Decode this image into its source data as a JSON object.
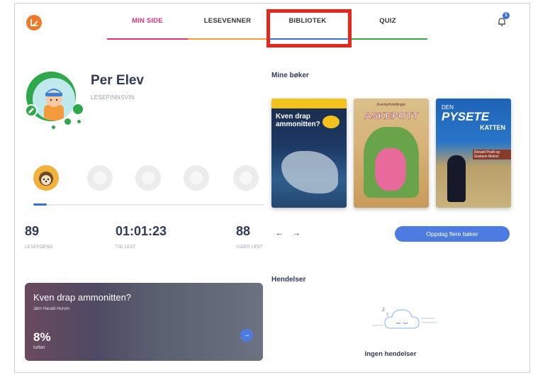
{
  "header": {
    "tabs": [
      {
        "label": "MIN SIDE"
      },
      {
        "label": "LESEVENNER"
      },
      {
        "label": "BIBLIOTEK"
      },
      {
        "label": "QUIZ"
      }
    ],
    "notification_count": "1",
    "colors": {
      "active_tab": "#e0317e",
      "highlight": "#e8271c"
    }
  },
  "profile": {
    "name": "Per Elev",
    "level": "LESEPINNSVIN"
  },
  "badges": {
    "active_index": 0,
    "count": 5,
    "progress_fraction": 0.06
  },
  "stats": [
    {
      "value": "89",
      "label": "LESEPOENG"
    },
    {
      "value": "01:01:23",
      "label": "TID LEST"
    },
    {
      "value": "88",
      "label": "SIDER LEST"
    }
  ],
  "current_book": {
    "title": "Kven drap ammonitten?",
    "author": "Jørn Harald Hurum",
    "percent": "8%",
    "percent_label": "fullført",
    "arrow": "→"
  },
  "my_books": {
    "title": "Mine bøker",
    "books": [
      {
        "title": "Kven drap ammonitten?"
      },
      {
        "subtitle": "Eventyrfortellinger",
        "title": "ASKEPOTT"
      },
      {
        "top": "DEN",
        "title": "PYSETE",
        "sub": "KATTEN",
        "authors": "Ronald Pruitt og Gustavo Muinzi"
      }
    ],
    "prev_arrow": "←",
    "next_arrow": "→",
    "discover_label": "Oppdag flere bøker"
  },
  "events": {
    "title": "Hendelser",
    "empty_label": "Ingen hendelser"
  }
}
